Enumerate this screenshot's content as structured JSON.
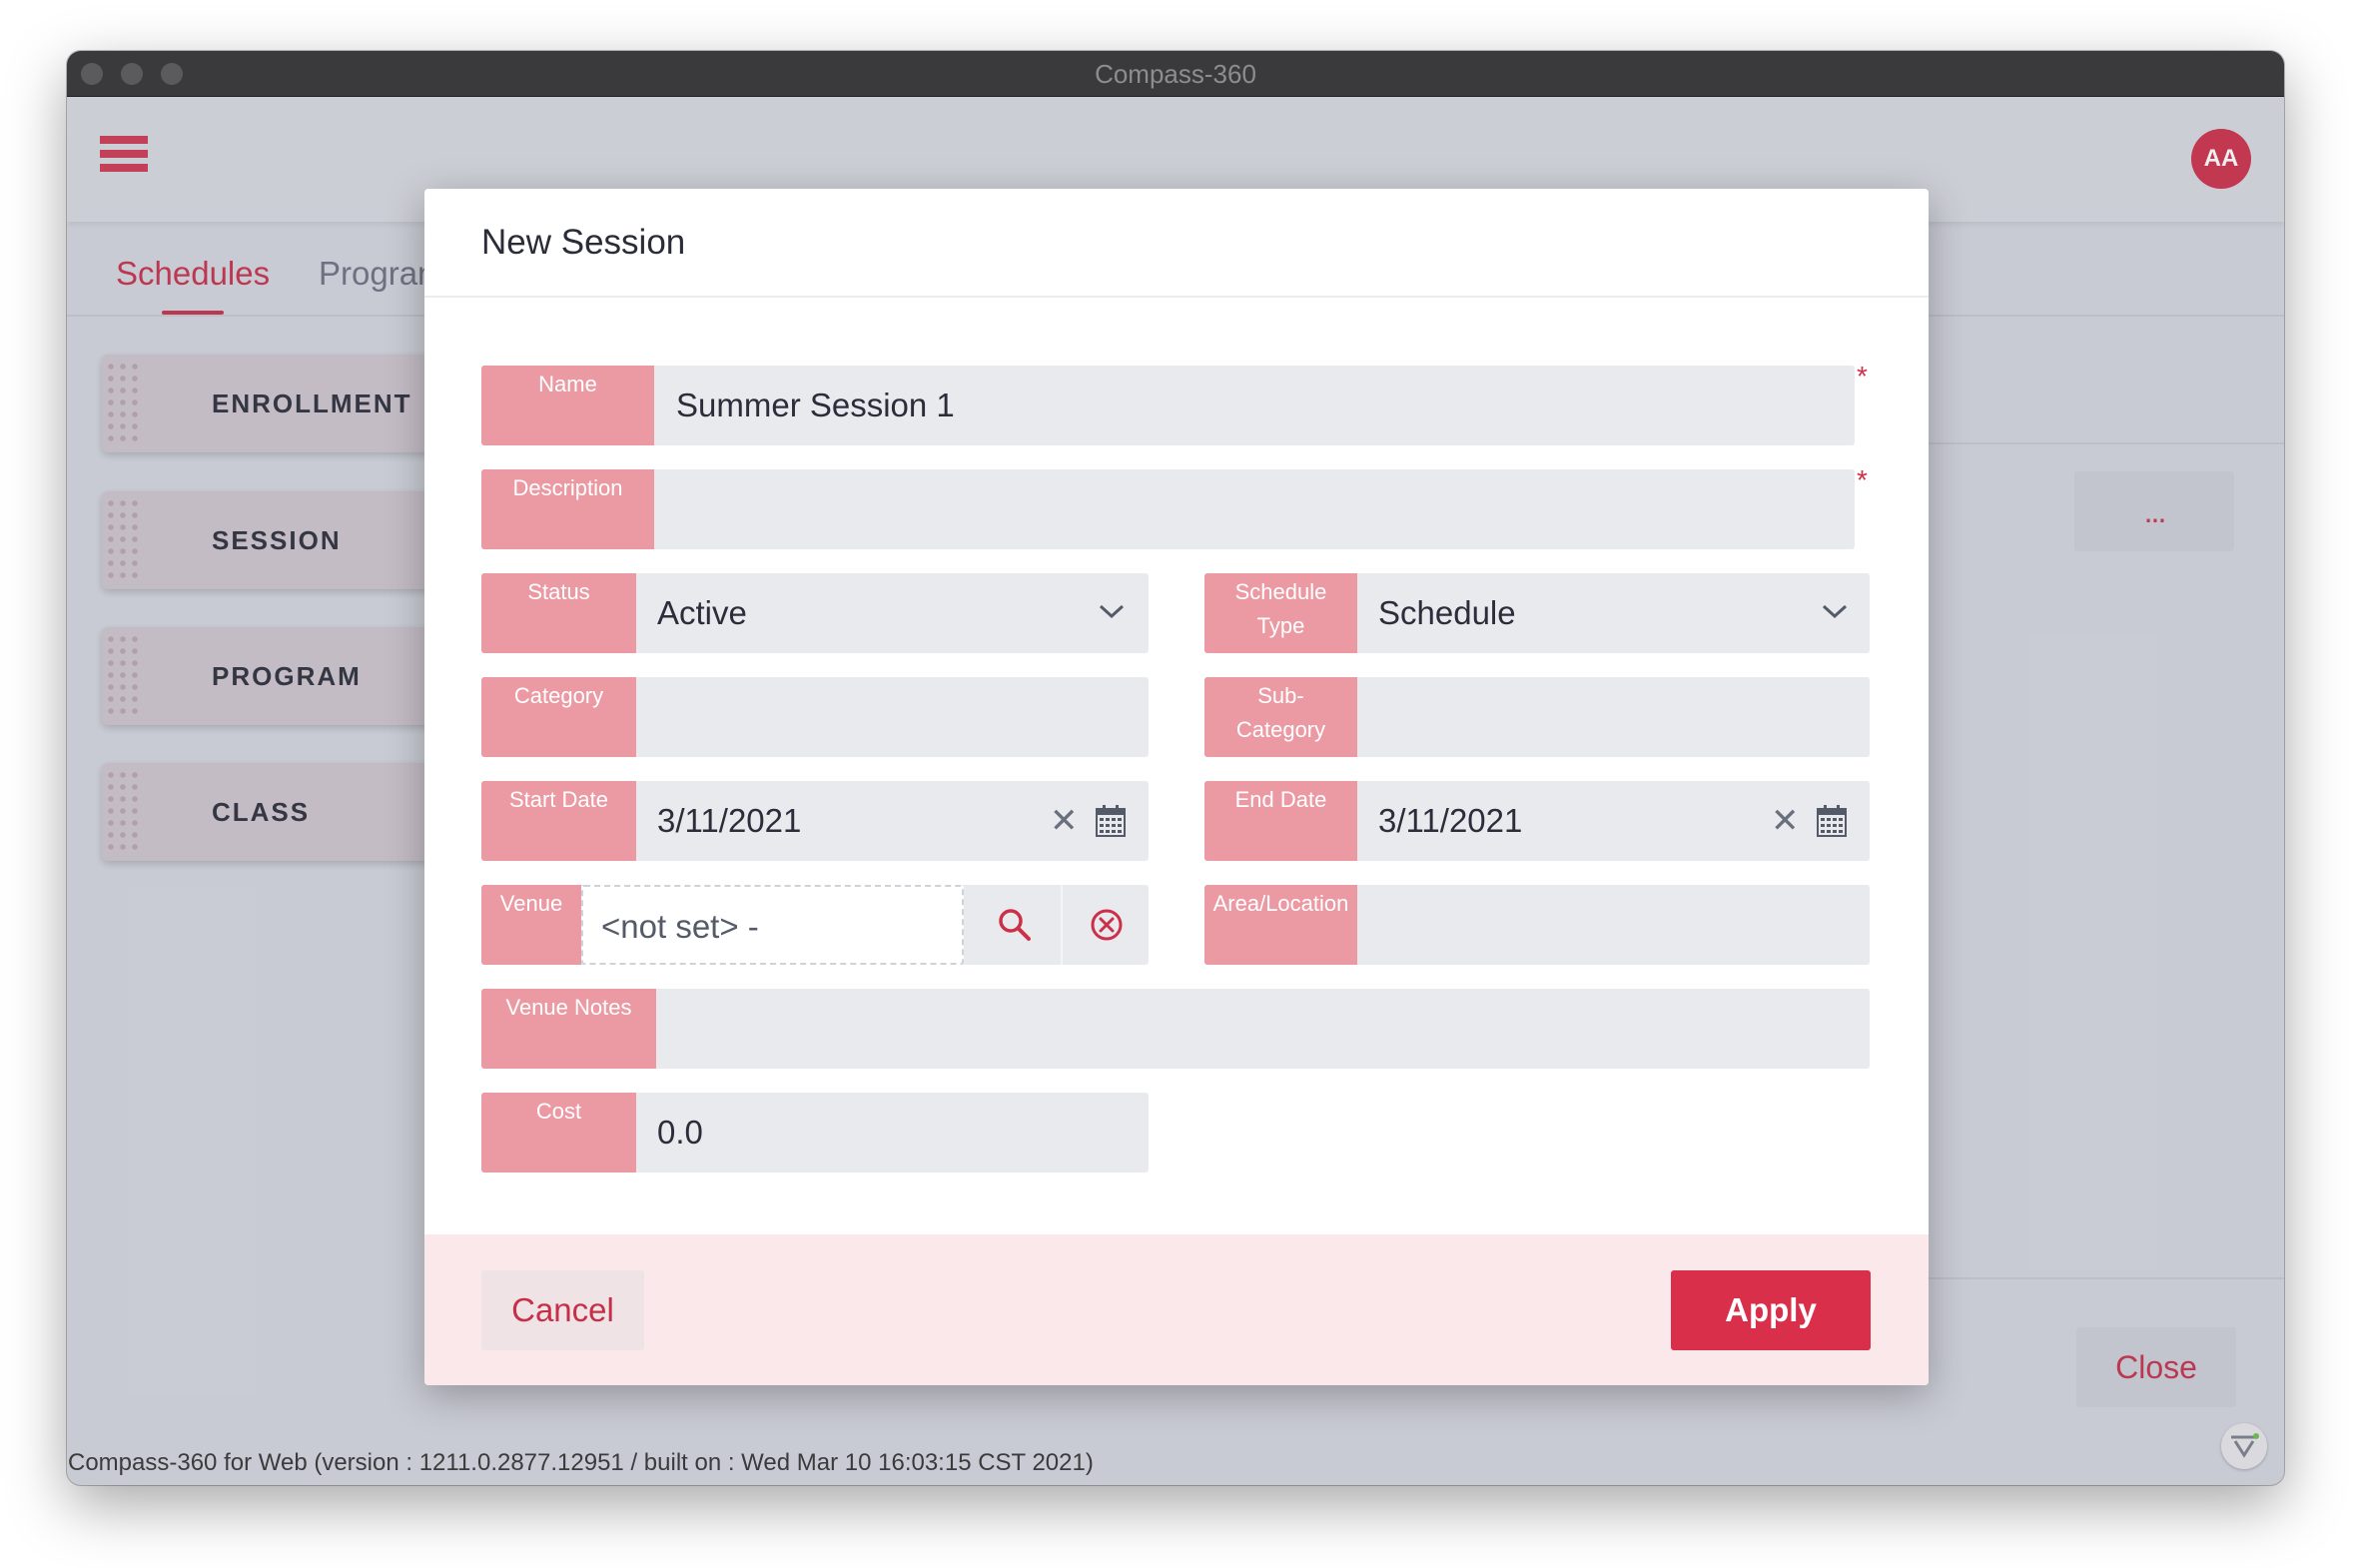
{
  "window": {
    "title": "Compass-360"
  },
  "header": {
    "avatar_initials": "AA"
  },
  "tabs": [
    {
      "label": "Schedules"
    },
    {
      "label": "Progran"
    }
  ],
  "sidebar": {
    "items": [
      {
        "label": "ENROLLMENT"
      },
      {
        "label": "SESSION"
      },
      {
        "label": "PROGRAM"
      },
      {
        "label": "CLASS"
      }
    ]
  },
  "page": {
    "more_label": "...",
    "close_label": "Close"
  },
  "dialog": {
    "title": "New Session",
    "required_mark": "*",
    "fields": {
      "name": {
        "label": "Name",
        "value": "Summer Session 1"
      },
      "description": {
        "label": "Description",
        "value": ""
      },
      "status": {
        "label": "Status",
        "value": "Active"
      },
      "schedule_type": {
        "label_line1": "Schedule",
        "label_line2": "Type",
        "value": "Schedule"
      },
      "category": {
        "label": "Category",
        "value": ""
      },
      "sub_category": {
        "label_line1": "Sub-",
        "label_line2": "Category",
        "value": ""
      },
      "start_date": {
        "label": "Start Date",
        "value": "3/11/2021"
      },
      "end_date": {
        "label": "End Date",
        "value": "3/11/2021"
      },
      "venue": {
        "label": "Venue",
        "value": "<not set> -"
      },
      "area_location": {
        "label": "Area/Location",
        "value": ""
      },
      "venue_notes": {
        "label": "Venue Notes",
        "value": ""
      },
      "cost": {
        "label": "Cost",
        "value": "0.0"
      }
    },
    "cancel_label": "Cancel",
    "apply_label": "Apply"
  },
  "footer": {
    "version_text": "Compass-360 for Web (version : 1211.0.2877.12951 / built on : Wed Mar 10 16:03:15 CST 2021)"
  },
  "icons": [
    "hamburger-menu-icon",
    "chevron-down-icon",
    "clear-icon",
    "calendar-icon",
    "search-icon",
    "cancel-circle-icon",
    "brand-logo-icon"
  ],
  "colors": {
    "accent": "#c52f48",
    "label_bg": "#eb9aa4",
    "field_bg": "#e8eaee",
    "apply_bg": "#d92f4b"
  }
}
